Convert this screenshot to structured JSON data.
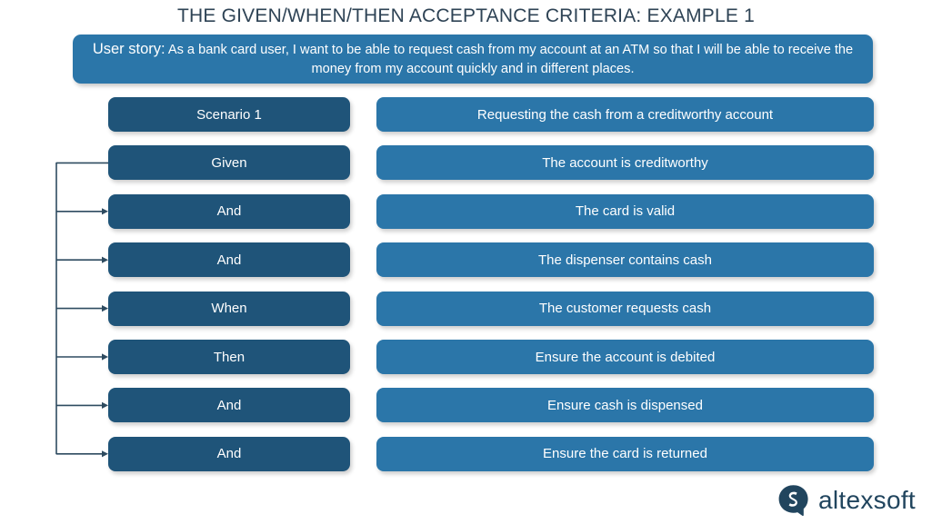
{
  "page": {
    "title": "THE GIVEN/WHEN/THEN ACCEPTANCE CRITERIA: EXAMPLE 1",
    "background_color": "#ffffff",
    "title_color": "#2e4355"
  },
  "user_story": {
    "label": "User story:",
    "text": " As a bank card user, I want to be able to request cash from my account at an ATM so that I will be able to receive the money from my account quickly and in different places.",
    "full_text": "User story: As a bank card user, I want to be able to request cash from my account at an ATM so that I will be able to receive the money from my account quickly and in different places.",
    "background_color": "#2b76a9",
    "text_color": "#ffffff"
  },
  "colors": {
    "keyword_box": "#1f5479",
    "statement_box": "#2b76a9",
    "connector": "#2e4b60",
    "logo": "#21455e"
  },
  "criteria_rows": [
    {
      "keyword": "Scenario 1",
      "statement": "Requesting the cash from a creditworthy account",
      "has_connector": false,
      "has_arrowhead": false
    },
    {
      "keyword": "Given",
      "statement": "The account is creditworthy",
      "has_connector": true,
      "has_arrowhead": false
    },
    {
      "keyword": "And",
      "statement": "The card is valid",
      "has_connector": true,
      "has_arrowhead": true
    },
    {
      "keyword": "And",
      "statement": "The dispenser contains cash",
      "has_connector": true,
      "has_arrowhead": true
    },
    {
      "keyword": "When",
      "statement": "The customer requests cash",
      "has_connector": true,
      "has_arrowhead": true
    },
    {
      "keyword": "Then",
      "statement": "Ensure the account is debited",
      "has_connector": true,
      "has_arrowhead": true
    },
    {
      "keyword": "And",
      "statement": "Ensure cash is dispensed",
      "has_connector": true,
      "has_arrowhead": true
    },
    {
      "keyword": "And",
      "statement": "Ensure the card is returned",
      "has_connector": true,
      "has_arrowhead": true
    }
  ],
  "logo": {
    "mark": "altexsoft-speech-bubble-icon",
    "wordmark": "altexsoft"
  }
}
